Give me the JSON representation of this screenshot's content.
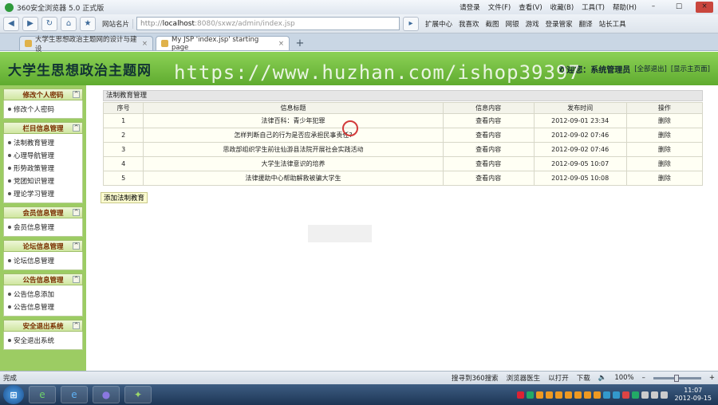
{
  "browser": {
    "title": "360安全浏览器 5.0 正式版",
    "menu": [
      "请登录",
      "文件(F)",
      "查看(V)",
      "收藏(B)",
      "工具(T)",
      "帮助(H)"
    ],
    "toolbar_label": "网站名片",
    "address": {
      "proto": "http://",
      "host": "localhost",
      "path": ":8080/sxwz/admin/index.jsp"
    },
    "toolbar_items": [
      "扩展中心",
      "我喜欢",
      "截图",
      "网银",
      "游戏",
      "登录管家",
      "翻译",
      "站长工具"
    ],
    "tabs": [
      {
        "label": "大学生思想政治主题网的设计与建设"
      },
      {
        "label": "My JSP 'index.jsp' starting page"
      }
    ]
  },
  "header": {
    "site_title": "大学生思想政治主题网",
    "watermark": "https://www.huzhan.com/ishop39397",
    "welcome": "欢迎您：系统管理员",
    "logout": "[全部退出]",
    "home": "[显示主页面]"
  },
  "sidebar": {
    "groups": [
      {
        "title": "修改个人密码",
        "items": [
          "修改个人密码"
        ]
      },
      {
        "title": "栏目信息管理",
        "items": [
          "法制教育管理",
          "心理导航管理",
          "形势政策管理",
          "党团知识管理",
          "理论学习管理"
        ]
      },
      {
        "title": "会员信息管理",
        "items": [
          "会员信息管理"
        ]
      },
      {
        "title": "论坛信息管理",
        "items": [
          "论坛信息管理"
        ]
      },
      {
        "title": "公告信息管理",
        "items": [
          "公告信息添加",
          "公告信息管理"
        ]
      },
      {
        "title": "安全退出系统",
        "items": [
          "安全退出系统"
        ]
      }
    ]
  },
  "main": {
    "panel_title": "法制教育管理",
    "columns": [
      "序号",
      "信息标题",
      "信息内容",
      "发布时间",
      "操作"
    ],
    "rows": [
      {
        "no": "1",
        "title": "法律百科：青少年犯罪",
        "content": "查看内容",
        "time": "2012-09-01 23:34",
        "action": "删除"
      },
      {
        "no": "2",
        "title": "怎样判断自己的行为是否应承担民事责任?",
        "content": "查看内容",
        "time": "2012-09-02 07:46",
        "action": "删除"
      },
      {
        "no": "3",
        "title": "思政部组织学生前往仙游县法院开展社会实践活动",
        "content": "查看内容",
        "time": "2012-09-02 07:46",
        "action": "删除"
      },
      {
        "no": "4",
        "title": "大学生法律意识的培养",
        "content": "查看内容",
        "time": "2012-09-05 10:07",
        "action": "删除"
      },
      {
        "no": "5",
        "title": "法律援助中心帮助解救被骗大学生",
        "content": "查看内容",
        "time": "2012-09-05 10:08",
        "action": "删除"
      }
    ],
    "add_button": "添加法制教育"
  },
  "statusbar": {
    "left": "完成",
    "items": [
      "搜寻到360搜索",
      "浏览器医生",
      "以打开",
      "下载"
    ],
    "zoom": "100%"
  },
  "taskbar": {
    "time": "11:07",
    "date": "2012-09-15"
  }
}
